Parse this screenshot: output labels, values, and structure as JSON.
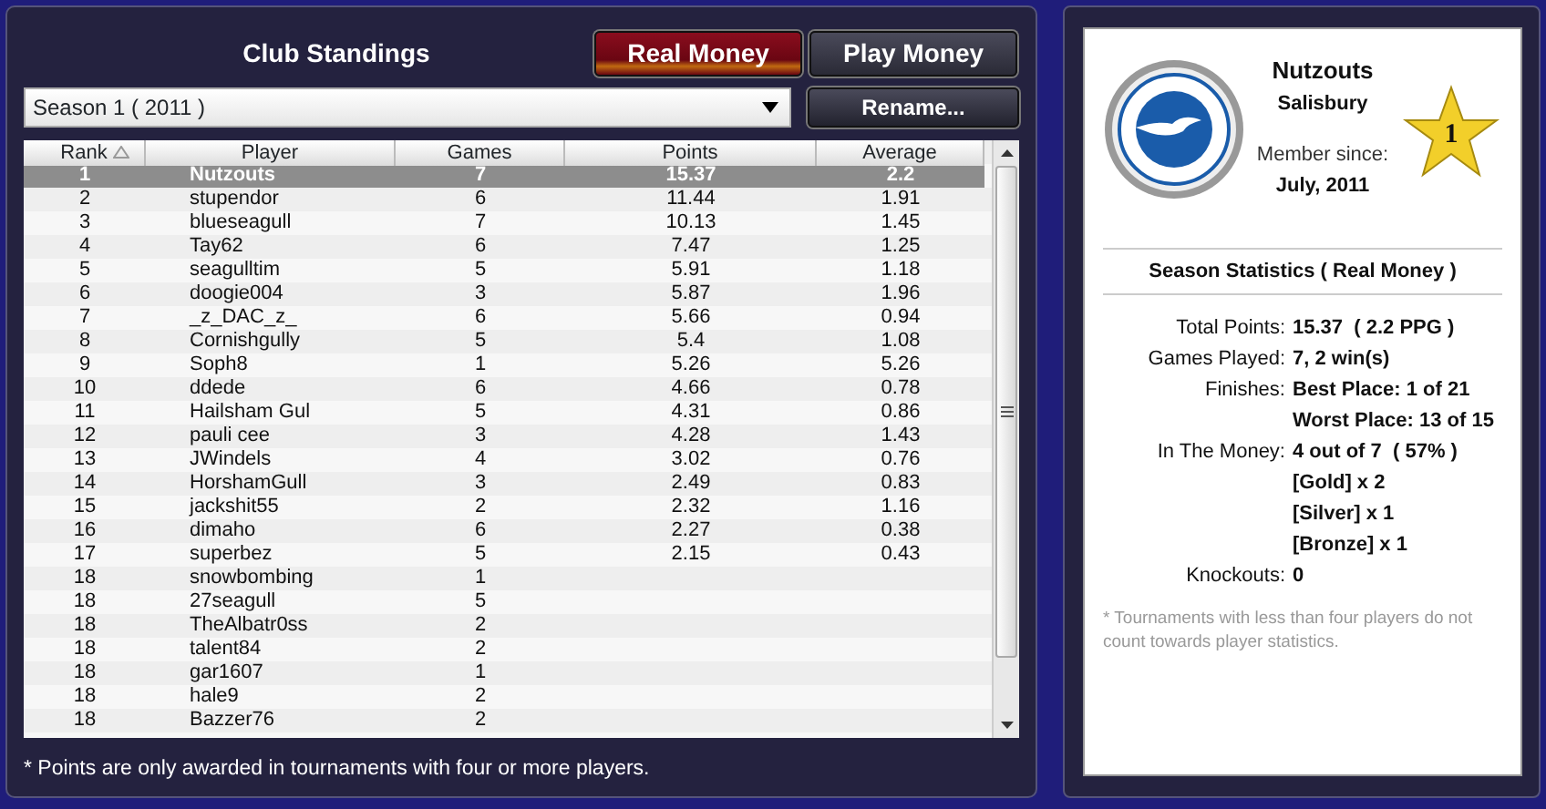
{
  "standings": {
    "title": "Club Standings",
    "tabs": [
      {
        "label": "Real Money",
        "selected": true
      },
      {
        "label": "Play Money",
        "selected": false
      }
    ],
    "season_select": {
      "value": "Season 1 ( 2011 )"
    },
    "rename_button": "Rename...",
    "columns": [
      {
        "label": "Rank",
        "sorted": true
      },
      {
        "label": "Player",
        "sorted": false
      },
      {
        "label": "Games",
        "sorted": false
      },
      {
        "label": "Points",
        "sorted": false
      },
      {
        "label": "Average",
        "sorted": false
      }
    ],
    "rows": [
      {
        "rank": "1",
        "player": "Nutzouts",
        "games": "7",
        "points": "15.37",
        "average": "2.2",
        "selected": true
      },
      {
        "rank": "2",
        "player": "stupendor",
        "games": "6",
        "points": "11.44",
        "average": "1.91",
        "selected": false
      },
      {
        "rank": "3",
        "player": "blueseagull",
        "games": "7",
        "points": "10.13",
        "average": "1.45",
        "selected": false
      },
      {
        "rank": "4",
        "player": "Tay62",
        "games": "6",
        "points": "7.47",
        "average": "1.25",
        "selected": false
      },
      {
        "rank": "5",
        "player": "seagulltim",
        "games": "5",
        "points": "5.91",
        "average": "1.18",
        "selected": false
      },
      {
        "rank": "6",
        "player": "doogie004",
        "games": "3",
        "points": "5.87",
        "average": "1.96",
        "selected": false
      },
      {
        "rank": "7",
        "player": "_z_DAC_z_",
        "games": "6",
        "points": "5.66",
        "average": "0.94",
        "selected": false
      },
      {
        "rank": "8",
        "player": "Cornishgully",
        "games": "5",
        "points": "5.4",
        "average": "1.08",
        "selected": false
      },
      {
        "rank": "9",
        "player": "Soph8",
        "games": "1",
        "points": "5.26",
        "average": "5.26",
        "selected": false
      },
      {
        "rank": "10",
        "player": "ddede",
        "games": "6",
        "points": "4.66",
        "average": "0.78",
        "selected": false
      },
      {
        "rank": "11",
        "player": "Hailsham Gul",
        "games": "5",
        "points": "4.31",
        "average": "0.86",
        "selected": false
      },
      {
        "rank": "12",
        "player": "pauli cee",
        "games": "3",
        "points": "4.28",
        "average": "1.43",
        "selected": false
      },
      {
        "rank": "13",
        "player": "JWindels",
        "games": "4",
        "points": "3.02",
        "average": "0.76",
        "selected": false
      },
      {
        "rank": "14",
        "player": "HorshamGull",
        "games": "3",
        "points": "2.49",
        "average": "0.83",
        "selected": false
      },
      {
        "rank": "15",
        "player": "jackshit55",
        "games": "2",
        "points": "2.32",
        "average": "1.16",
        "selected": false
      },
      {
        "rank": "16",
        "player": "dimaho",
        "games": "6",
        "points": "2.27",
        "average": "0.38",
        "selected": false
      },
      {
        "rank": "17",
        "player": "superbez",
        "games": "5",
        "points": "2.15",
        "average": "0.43",
        "selected": false
      },
      {
        "rank": "18",
        "player": "snowbombing",
        "games": "1",
        "selected": false
      },
      {
        "rank": "18",
        "player": "27seagull",
        "games": "5",
        "selected": false
      },
      {
        "rank": "18",
        "player": "TheAlbatr0ss",
        "games": "2",
        "selected": false
      },
      {
        "rank": "18",
        "player": "talent84",
        "games": "2",
        "selected": false
      },
      {
        "rank": "18",
        "player": "gar1607",
        "games": "1",
        "selected": false
      },
      {
        "rank": "18",
        "player": "hale9",
        "games": "2",
        "selected": false
      },
      {
        "rank": "18",
        "player": "Bazzer76",
        "games": "2",
        "selected": false
      }
    ],
    "footnote": "* Points are only awarded in tournaments with four or more players."
  },
  "profile": {
    "name": "Nutzouts",
    "location": "Salisbury",
    "member_label": "Member since:",
    "member_date": "July, 2011",
    "rank_badge": "1",
    "stats_title": "Season Statistics ( Real Money )",
    "stats": [
      {
        "label": "Total Points:",
        "value": "15.37  ( 2.2 PPG )"
      },
      {
        "label": "Games Played:",
        "value": "7, 2 win(s)"
      },
      {
        "label": "Finishes:",
        "value": "Best Place: 1 of 21"
      },
      {
        "value": "Worst Place: 13 of 15"
      },
      {
        "label": "In The Money:",
        "value": "4 out of 7  ( 57% )"
      },
      {
        "value": "[Gold] x 2"
      },
      {
        "value": "[Silver] x 1"
      },
      {
        "value": "[Bronze] x 1"
      },
      {
        "label": "Knockouts:",
        "value": "0"
      }
    ],
    "note": "* Tournaments with less than four players do not count towards player statistics."
  }
}
